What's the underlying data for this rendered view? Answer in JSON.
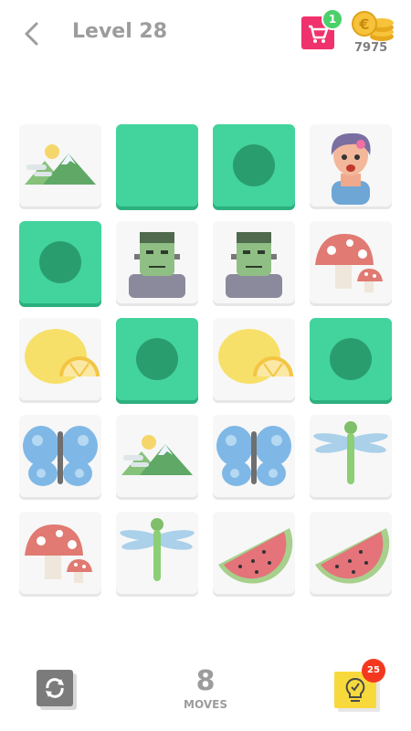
{
  "header": {
    "title": "Level 28",
    "cart_badge": "1",
    "coins": "7975"
  },
  "board": {
    "rows": [
      [
        "mountains",
        "revealed",
        "revealed-empty",
        "zombie-girl"
      ],
      [
        "revealed-empty",
        "frankenstein",
        "frankenstein",
        "mushroom"
      ],
      [
        "lemon",
        "revealed-empty",
        "lemon",
        "revealed-empty"
      ],
      [
        "butterfly",
        "mountains",
        "butterfly",
        "dragonfly"
      ],
      [
        "mushroom",
        "dragonfly",
        "watermelon",
        "watermelon"
      ]
    ]
  },
  "footer": {
    "moves": "8",
    "moves_label": "MOVES",
    "hint_badge": "25"
  },
  "colors": {
    "green": "#42d49c",
    "green_dot": "#2a9d6e",
    "cart": "#f0326c",
    "badge_green": "#4ad16a",
    "badge_red": "#f4381f"
  }
}
